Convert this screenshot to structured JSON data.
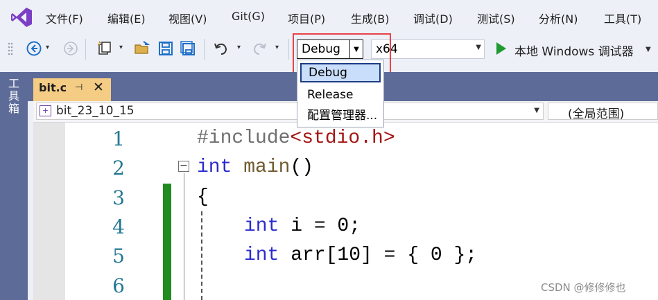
{
  "menu": [
    "文件(F)",
    "编辑(E)",
    "视图(V)",
    "Git(G)",
    "项目(P)",
    "生成(B)",
    "调试(D)",
    "测试(S)",
    "分析(N)",
    "工具(T)"
  ],
  "toolbar": {
    "config_value": "Debug",
    "platform_value": "x64",
    "run_label": "本地 Windows 调试器"
  },
  "config_dropdown": {
    "options": [
      "Debug",
      "Release",
      "配置管理器..."
    ],
    "selected": "Debug"
  },
  "toolbox_label": "工具箱",
  "tab": {
    "label": "bit.c"
  },
  "navbar": {
    "scope": "bit_23_10_15",
    "global": "(全局范围)"
  },
  "editor": {
    "line_numbers": [
      "1",
      "2",
      "3",
      "4",
      "5",
      "6"
    ],
    "code": {
      "l1_directive": "#include",
      "l1_header": "<stdio.h>",
      "l2_type": "int",
      "l2_name": " main",
      "l2_paren": "()",
      "l3": "{",
      "l4_type": "int",
      "l4_rest": " i = 0;",
      "l5_type": "int",
      "l5_rest": " arr[10] = { 0 };"
    }
  },
  "watermark": "CSDN @修修修也",
  "colors": {
    "accent_highlight": "#e8424a",
    "run_green": "#1f9a32",
    "tab_active": "#f5cc84",
    "chrome": "#5d6b99"
  }
}
